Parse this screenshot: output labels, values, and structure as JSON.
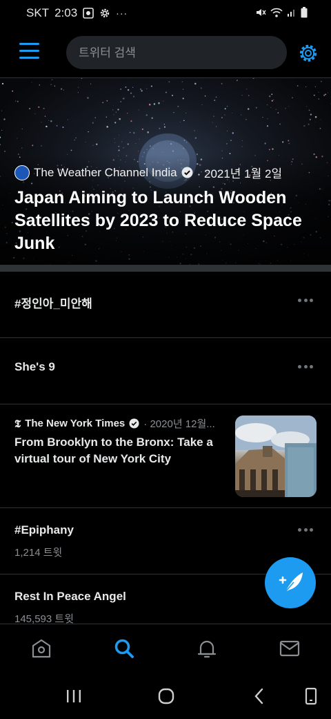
{
  "status_bar": {
    "carrier": "SKT",
    "time": "2:03",
    "more_indicator": "···"
  },
  "search": {
    "placeholder": "트위터 검색"
  },
  "hero": {
    "source": "The Weather Channel India",
    "date": "· 2021년 1월 2일",
    "title": "Japan Aiming to Launch Wooden Satellites by 2023 to Reduce Space Junk"
  },
  "trends": [
    {
      "title": "#정인아_미안해"
    },
    {
      "title": "She's 9"
    },
    {
      "title": "#Epiphany",
      "count": "1,214 트윗"
    },
    {
      "title": "Rest In Peace Angel",
      "count": "145,593 트윗"
    }
  ],
  "news": {
    "source": "The New York Times",
    "date": "· 2020년 12월...",
    "title": "From Brooklyn to the Bronx: Take a virtual tour of New York City"
  },
  "colors": {
    "accent": "#1d9bf0",
    "background": "#000000",
    "divider": "#2f3336"
  },
  "tabs": [
    "home-icon",
    "search-icon",
    "notifications-icon",
    "messages-icon"
  ],
  "nav_buttons": [
    "recents-icon",
    "home-circle-icon",
    "back-icon",
    "screenshot-icon"
  ]
}
